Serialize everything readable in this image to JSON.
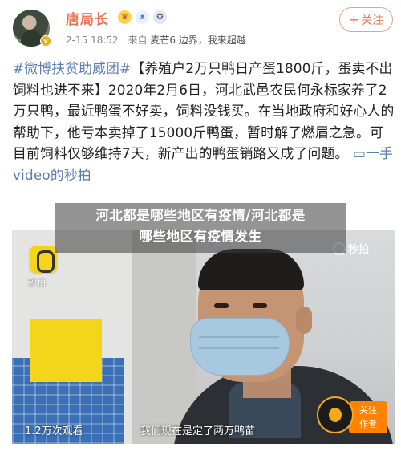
{
  "header": {
    "username": "唐局长",
    "badges": [
      "crown-badge",
      "rabbit-badge",
      "medal-badge"
    ],
    "verified_icon": "v",
    "date": "2-15 18:52",
    "source_prefix": "来自",
    "source_device": "麦芒6 边界，我来超越",
    "follow_label": "关注",
    "follow_plus": "+"
  },
  "post": {
    "topic": "#微博扶贫助威团#",
    "body": "【养殖户2万只鸭日产蛋1800斤，蛋卖不出饲料也进不来】2020年2月6日，河北武邑农民何永标家养了2万只鸭，最近鸭蛋不好卖，饲料没钱买。在当地政府和好心人的帮助下，他亏本卖掉了15000斤鸭蛋，暂时解了燃眉之急。可目前饲料仅够维持7天，新产出的鸭蛋销路又成了问题。",
    "link_icon": "▭",
    "link_text": "一手video的秒拍"
  },
  "video": {
    "logo_text": "秒拍",
    "watermark": "秒拍",
    "view_count": "1.2万次观看",
    "subtitle": "我们现在是定了两万鸭苗",
    "author_follow": "关注",
    "author_label": "作者"
  },
  "banner": {
    "line1": "河北都是哪些地区有疫情/河北都是",
    "line2": "哪些地区有疫情发生"
  },
  "colors": {
    "username": "#eb7350",
    "link": "#5b7fb5",
    "follow_border": "#e0a48a"
  }
}
